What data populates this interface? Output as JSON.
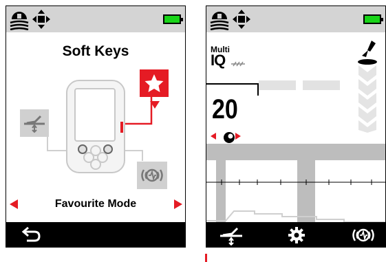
{
  "colors": {
    "accent_red": "#e51b24",
    "status_gray": "#d4d4d4",
    "battery_green": "#18d418",
    "bar_gray": "#bdbdbd"
  },
  "left_screen": {
    "status_icons": [
      "terrain-icon",
      "move-arrows-icon",
      "battery-icon"
    ],
    "title": "Soft Keys",
    "mode_label": "Favourite Mode",
    "icons": [
      "favourite-star-icon",
      "pinpoint-icon",
      "wireless-audio-icon",
      "back-icon"
    ]
  },
  "right_screen": {
    "status_icons": [
      "terrain-icon",
      "move-arrows-icon",
      "battery-icon"
    ],
    "program_label": "Multi",
    "program_name": "IQ",
    "value": "20",
    "icons": [
      "shovel-icon",
      "sensitivity-dial-icon",
      "pinpoint-icon",
      "settings-gear-icon",
      "wireless-audio-icon"
    ]
  }
}
